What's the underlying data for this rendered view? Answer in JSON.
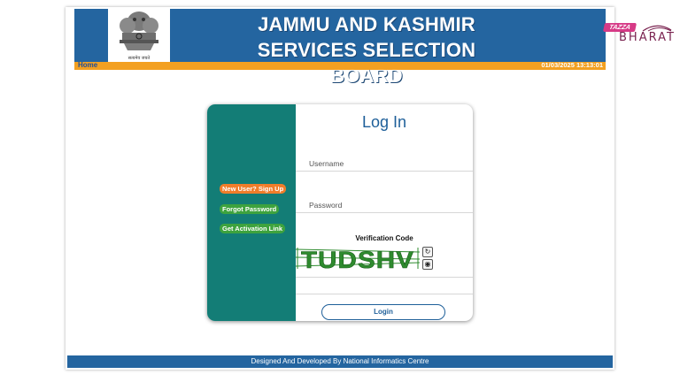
{
  "header": {
    "title_line1": "JAMMU AND KASHMIR",
    "title_line2": "SERVICES SELECTION BOARD",
    "emblem_caption": "सत्यमेव जयते"
  },
  "nav": {
    "home": "Home",
    "datetime": "01/03/2025 13:13:01"
  },
  "login": {
    "title": "Log In",
    "username_placeholder": "Username",
    "password_placeholder": "Password",
    "captcha_label": "Verification Code",
    "captcha_text": "TUDSHV",
    "login_button": "Login"
  },
  "side_links": {
    "signup": "New User? Sign Up",
    "forgot": "Forgot Password",
    "activation": "Get Activation Link"
  },
  "footer": {
    "text": "Designed And Developed By National Informatics Centre"
  },
  "watermark": {
    "tag": "TAZZA",
    "word": "BHARAT"
  },
  "colors": {
    "banner_blue": "#2465a0",
    "nav_orange": "#f3a021",
    "teal": "#137d76",
    "signup_orange": "#f07d2a",
    "link_green": "#3ea33e",
    "captcha_green": "#2e8b2e"
  },
  "icons": [
    "refresh-icon",
    "audio-icon"
  ]
}
